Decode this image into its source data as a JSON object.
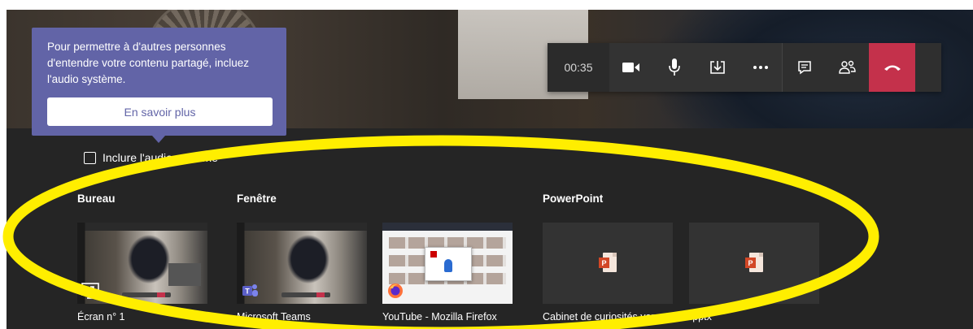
{
  "toolbar": {
    "timer": "00:35",
    "buttons": [
      "camera-icon",
      "microphone-icon",
      "share-tray-icon",
      "more-options-icon",
      "chat-icon",
      "participants-icon",
      "hang-up-icon"
    ]
  },
  "tooltip": {
    "text": "Pour permettre à d'autres personnes d'entendre votre contenu partagé, incluez l'audio système.",
    "button": "En savoir plus"
  },
  "include_audio": {
    "label": "Inclure l'audio système",
    "checked": false
  },
  "sections": {
    "desktop": {
      "title": "Bureau",
      "items": [
        {
          "label": "Écran n° 1",
          "icon": "screen-share-icon"
        }
      ]
    },
    "window": {
      "title": "Fenêtre",
      "items": [
        {
          "label": "Microsoft Teams",
          "icon": "teams-icon"
        },
        {
          "label": "YouTube - Mozilla Firefox",
          "icon": "firefox-icon"
        }
      ]
    },
    "powerpoint": {
      "title": "PowerPoint",
      "items": [
        {
          "label": "Cabinet de curiosités vers...",
          "icon": "powerpoint-file-icon"
        },
        {
          "label": "hi.pptx",
          "icon": "powerpoint-file-icon"
        }
      ]
    }
  },
  "colors": {
    "accent": "#6264a7",
    "hangup": "#c4314b",
    "annotation": "#ffee00",
    "background": "#292929"
  }
}
